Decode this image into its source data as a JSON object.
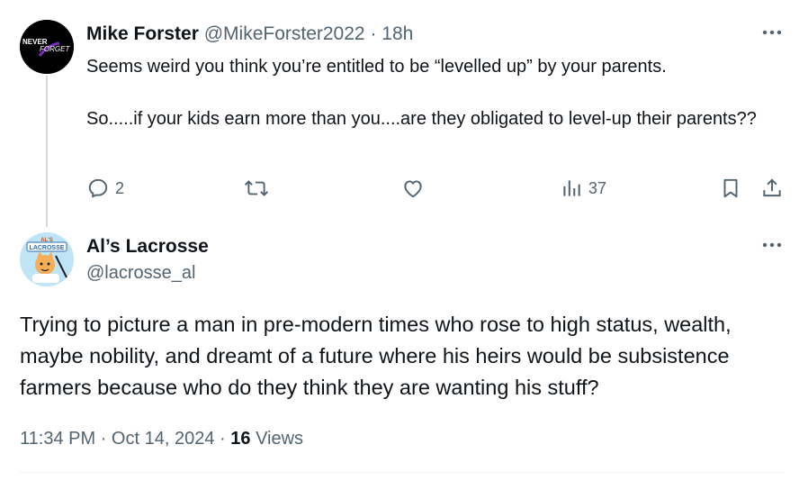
{
  "reply": {
    "avatar_lines": [
      "NEVER",
      "FORGET"
    ],
    "name": "Mike Forster",
    "handle": "@MikeForster2022",
    "separator": "·",
    "time": "18h",
    "paragraphs": [
      "Seems weird you think you’re entitled to be “levelled up” by your parents.",
      "So.....if your kids earn more than you....are they obligated to level-up their parents??"
    ],
    "reply_count": "2",
    "views_count": "37"
  },
  "main": {
    "avatar_lines": [
      "AL'S",
      "LACROSSE"
    ],
    "name": "Al’s Lacrosse",
    "handle": "@lacrosse_al",
    "text": "Trying to picture a man in pre-modern times who rose to high status, wealth, maybe nobility, and dreamt of a future where his heirs would be subsistence farmers because who do they think they are wanting his stuff?",
    "time": "11:34 PM",
    "separator": "·",
    "date": "Oct 14, 2024",
    "views_count": "16",
    "views_label": "Views"
  },
  "colors": {
    "text": "#0f1419",
    "secondary": "#536471",
    "thread_line": "#cfd9de",
    "divider": "#eff3f4"
  }
}
